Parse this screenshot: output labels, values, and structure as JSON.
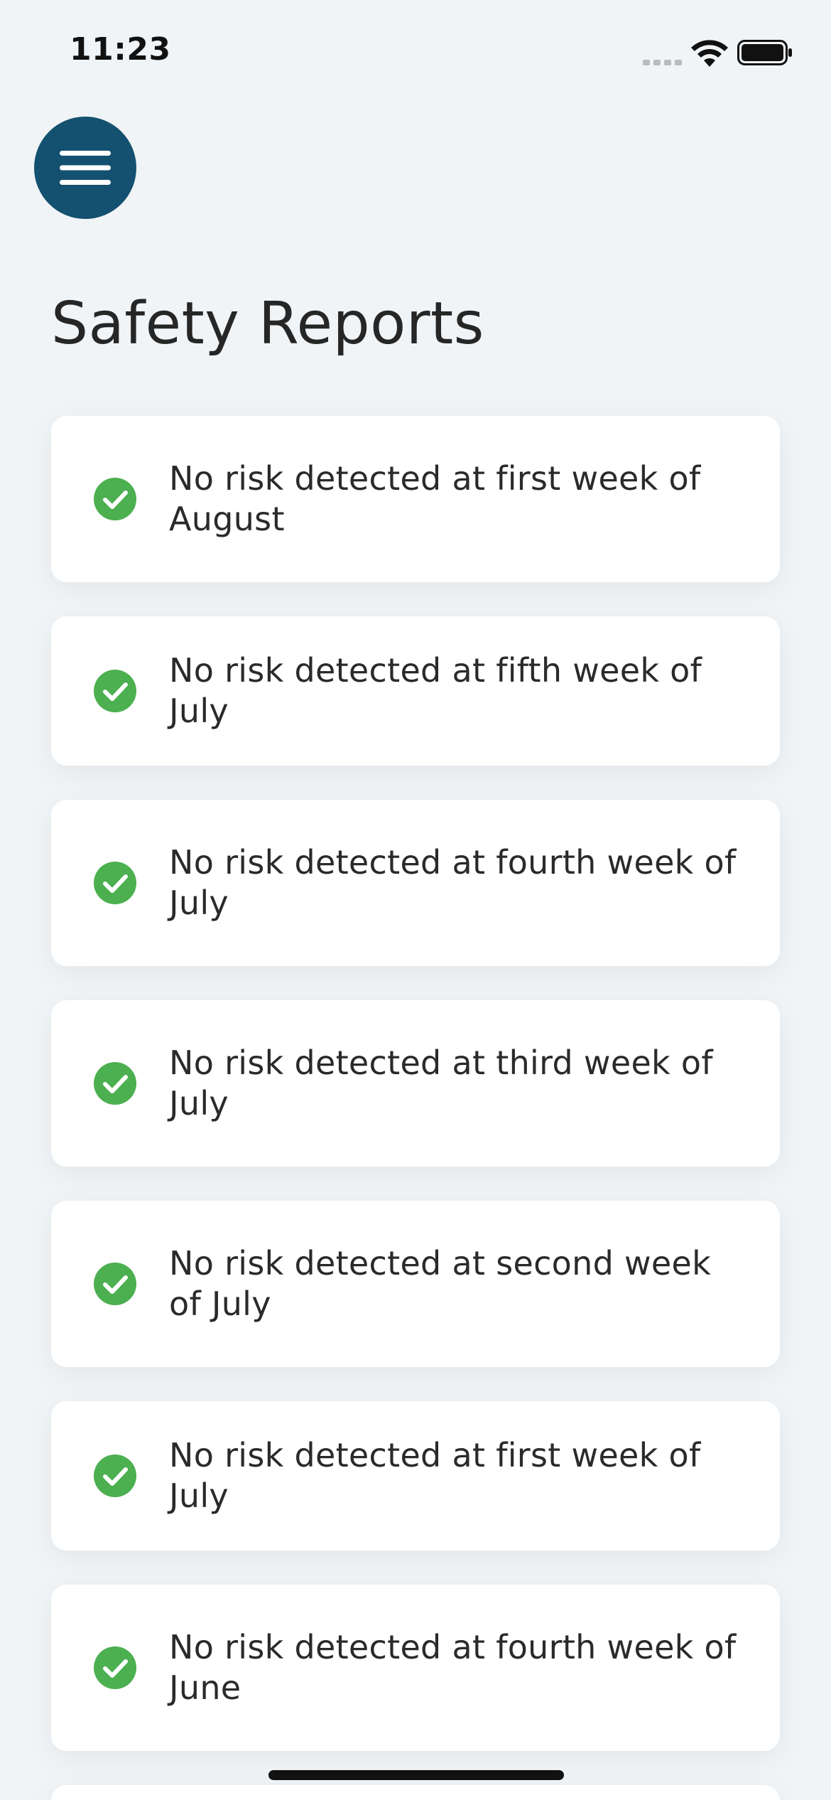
{
  "status_bar": {
    "time": "11:23",
    "icons": [
      "cellular-signal-icon",
      "wifi-icon",
      "battery-icon"
    ]
  },
  "menu_button": {
    "icon": "hamburger-menu-icon",
    "color": "#14506f"
  },
  "title": "Safety Reports",
  "reports": [
    {
      "text": "No risk detected at first week of August",
      "icon": "check-circle-icon"
    },
    {
      "text": "No risk detected at fifth week of July",
      "icon": "check-circle-icon"
    },
    {
      "text": "No risk detected at fourth week of July",
      "icon": "check-circle-icon"
    },
    {
      "text": "No risk detected at third week of July",
      "icon": "check-circle-icon"
    },
    {
      "text": "No risk detected at second week of July",
      "icon": "check-circle-icon"
    },
    {
      "text": "No risk detected at first week of July",
      "icon": "check-circle-icon"
    },
    {
      "text": "No risk detected at fourth week of June",
      "icon": "check-circle-icon"
    }
  ],
  "colors": {
    "background": "#f0f4f7",
    "card": "#ffffff",
    "accent": "#14506f",
    "success": "#4caf50"
  }
}
